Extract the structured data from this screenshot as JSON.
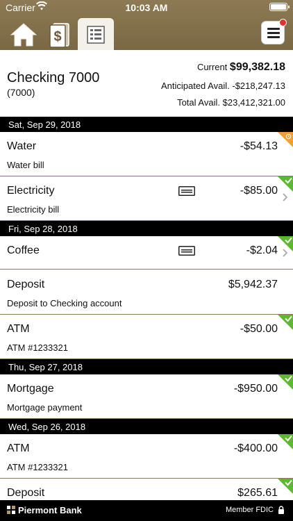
{
  "status_bar": {
    "carrier": "Carrier",
    "time": "10:03 AM"
  },
  "account": {
    "name": "Checking 7000",
    "number": "(7000)",
    "current_label": "Current",
    "current_value": "$99,382.18",
    "anticipated_label": "Anticipated Avail.",
    "anticipated_value": "-$218,247.13",
    "total_label": "Total Avail.",
    "total_value": "$23,412,321.00"
  },
  "groups": [
    {
      "date": "Sat, Sep 29, 2018"
    },
    {
      "date": "Fri, Sep 28, 2018"
    },
    {
      "date": "Thu, Sep 27, 2018"
    },
    {
      "date": "Wed, Sep 26, 2018"
    }
  ],
  "transactions": [
    {
      "name": "Water",
      "desc": "Water bill",
      "amount": "-$54.13",
      "status": "pending"
    },
    {
      "name": "Electricity",
      "desc": "Electricity bill",
      "amount": "-$85.00",
      "status": "cleared"
    },
    {
      "name": "Coffee",
      "desc": "",
      "amount": "-$2.04",
      "status": "cleared"
    },
    {
      "name": "Deposit",
      "desc": "Deposit to Checking account",
      "amount": "$5,942.37",
      "status": "none"
    },
    {
      "name": "ATM",
      "desc": "ATM #1233321",
      "amount": "-$50.00",
      "status": "cleared"
    },
    {
      "name": "Mortgage",
      "desc": "Mortgage payment",
      "amount": "-$950.00",
      "status": "cleared"
    },
    {
      "name": "ATM",
      "desc": "ATM #1233321",
      "amount": "-$400.00",
      "status": "cleared"
    },
    {
      "name": "Deposit",
      "desc": "",
      "amount": "$265.61",
      "status": "cleared"
    }
  ],
  "footer": {
    "bank_name": "Piermont Bank",
    "fdic": "Member FDIC"
  },
  "colors": {
    "header": "#8d7a55",
    "cleared": "#5cb82e",
    "pending": "#f0a030"
  }
}
